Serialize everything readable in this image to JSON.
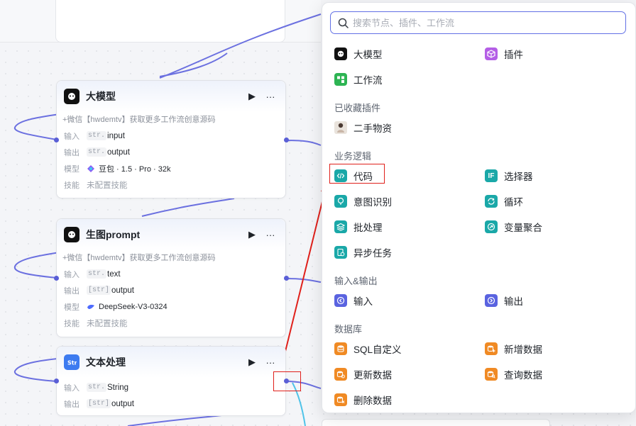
{
  "nodes": [
    {
      "id": "llm",
      "title": "大模型",
      "icon": "robot-icon",
      "subtitle": "+微信【hwdemtv】获取更多工作流创意源码",
      "input_label": "输入",
      "input_type": "str.",
      "input_value": "input",
      "output_label": "输出",
      "output_type": "str.",
      "output_value": "output",
      "model_label": "模型",
      "model_value": "豆包 · 1.5 · Pro · 32k",
      "skill_label": "技能",
      "skill_value": "未配置技能"
    },
    {
      "id": "image-prompt",
      "title": "生图prompt",
      "icon": "robot-icon",
      "subtitle": "+微信【hwdemtv】获取更多工作流创意源码",
      "input_label": "输入",
      "input_type": "str.",
      "input_value": "text",
      "output_label": "输出",
      "output_type": "[str]",
      "output_value": "output",
      "model_label": "模型",
      "model_value": "DeepSeek-V3-0324",
      "skill_label": "技能",
      "skill_value": "未配置技能"
    },
    {
      "id": "text-process",
      "title": "文本处理",
      "icon": "text-process-icon",
      "input_label": "输入",
      "input_type": "str.",
      "input_value": "String",
      "output_label": "输出",
      "output_type": "[str]",
      "output_value": "output"
    }
  ],
  "panel": {
    "search_placeholder": "搜索节点、插件、工作流",
    "top_items": [
      {
        "label": "大模型",
        "icon": "robot-icon",
        "color": "#1f2329"
      },
      {
        "label": "插件",
        "icon": "cube-icon",
        "color": "#b45ee6"
      },
      {
        "label": "工作流",
        "icon": "workflow-icon",
        "color": "#2db453"
      }
    ],
    "groups": [
      {
        "title": "已收藏插件",
        "items": [
          {
            "label": "二手物资",
            "icon": "avatar-icon"
          }
        ]
      },
      {
        "title": "业务逻辑",
        "items": [
          {
            "label": "代码",
            "icon": "code-icon",
            "color": "#1aa8a8"
          },
          {
            "label": "选择器",
            "icon": "if-icon",
            "color": "#1aa8a8"
          },
          {
            "label": "意图识别",
            "icon": "intent-icon",
            "color": "#1aa8a8"
          },
          {
            "label": "循环",
            "icon": "loop-icon",
            "color": "#1aa8a8"
          },
          {
            "label": "批处理",
            "icon": "batch-icon",
            "color": "#1aa8a8"
          },
          {
            "label": "变量聚合",
            "icon": "aggregate-icon",
            "color": "#1aa8a8"
          },
          {
            "label": "异步任务",
            "icon": "async-icon",
            "color": "#1aa8a8"
          }
        ]
      },
      {
        "title": "输入&输出",
        "items": [
          {
            "label": "输入",
            "icon": "input-icon",
            "color": "#5a63e0"
          },
          {
            "label": "输出",
            "icon": "output-icon",
            "color": "#5a63e0"
          }
        ]
      },
      {
        "title": "数据库",
        "items": [
          {
            "label": "SQL自定义",
            "icon": "sql-icon",
            "color": "#f08a24"
          },
          {
            "label": "新增数据",
            "icon": "db-add-icon",
            "color": "#f08a24"
          },
          {
            "label": "更新数据",
            "icon": "db-update-icon",
            "color": "#f08a24"
          },
          {
            "label": "查询数据",
            "icon": "db-query-icon",
            "color": "#f08a24"
          },
          {
            "label": "删除数据",
            "icon": "db-delete-icon",
            "color": "#f08a24"
          }
        ]
      }
    ]
  },
  "colors": {
    "edge": "#6b70e0",
    "accent": "#6270e5",
    "highlight": "#e0201b",
    "teal_link": "#4fc3e8"
  }
}
